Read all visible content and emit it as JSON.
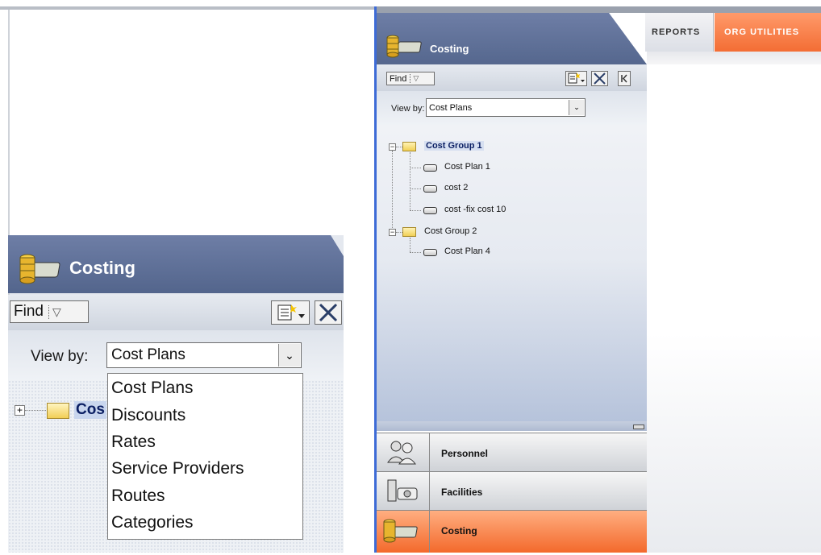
{
  "zoom_panel": {
    "title": "Costing",
    "find_label": "Find",
    "view_by_label": "View by:",
    "view_by_value": "Cost Plans",
    "tree_root_partial": "Cos",
    "dropdown_options": [
      "Cost Plans",
      "Discounts",
      "Rates",
      "Service Providers",
      "Routes",
      "Categories"
    ]
  },
  "app": {
    "title": "Costing",
    "tabs": [
      {
        "label": "Reports"
      },
      {
        "label": "Org Utilities"
      }
    ],
    "toolbar": {
      "find_label": "Find"
    },
    "view_by_label": "View by:",
    "view_by_value": "Cost Plans",
    "tree": [
      {
        "label": "Cost Group 1",
        "children": [
          "Cost Plan 1",
          "cost 2",
          "cost -fix cost 10"
        ]
      },
      {
        "label": "Cost Group 2",
        "children": [
          "Cost Plan 4"
        ]
      }
    ],
    "nav": [
      {
        "label": "Personnel"
      },
      {
        "label": "Facilities"
      },
      {
        "label": "Costing"
      }
    ],
    "colors": {
      "accent_orange": "#f36d34",
      "title_blue": "#5a6b93",
      "window_border": "#3d6bd6"
    }
  }
}
